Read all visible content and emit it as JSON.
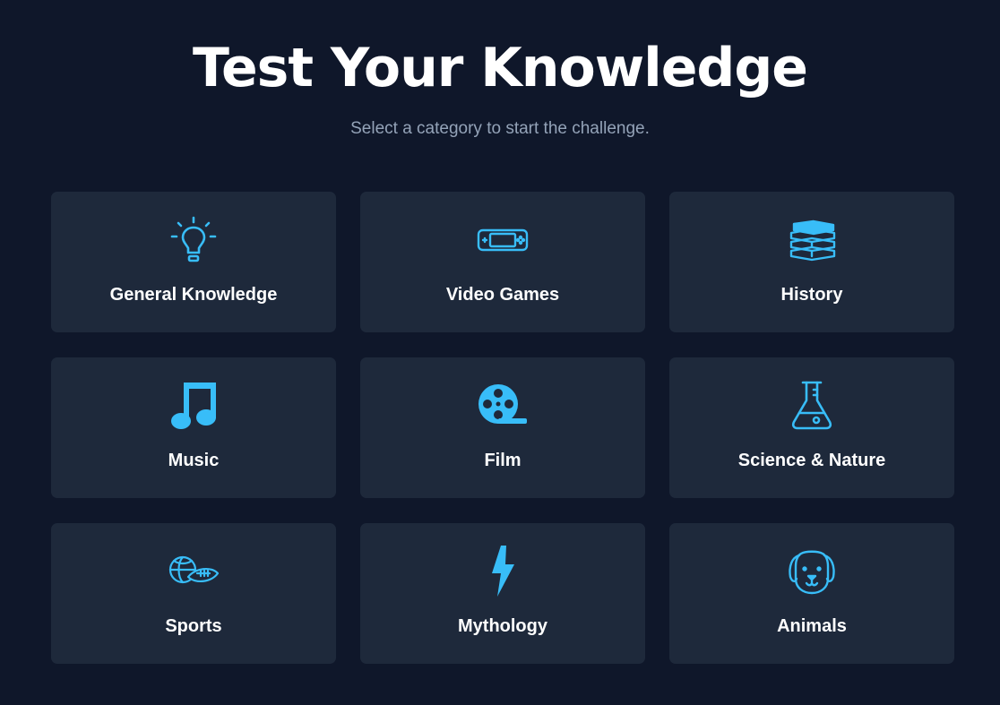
{
  "header": {
    "title": "Test Your Knowledge",
    "subtitle": "Select a category to start the challenge."
  },
  "accent_color": "#38bdf8",
  "categories": [
    {
      "label": "General Knowledge",
      "icon": "lightbulb-icon"
    },
    {
      "label": "Video Games",
      "icon": "handheld-console-icon"
    },
    {
      "label": "History",
      "icon": "book-stack-icon"
    },
    {
      "label": "Music",
      "icon": "music-note-icon"
    },
    {
      "label": "Film",
      "icon": "film-reel-icon"
    },
    {
      "label": "Science & Nature",
      "icon": "flask-icon"
    },
    {
      "label": "Sports",
      "icon": "sports-balls-icon"
    },
    {
      "label": "Mythology",
      "icon": "lightning-bolt-icon"
    },
    {
      "label": "Animals",
      "icon": "dog-face-icon"
    }
  ]
}
